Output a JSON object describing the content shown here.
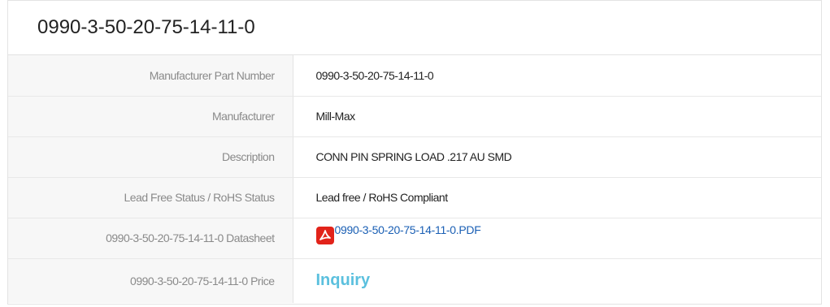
{
  "title": "0990-3-50-20-75-14-11-0",
  "rows": [
    {
      "label": "Manufacturer Part Number",
      "value": "0990-3-50-20-75-14-11-0"
    },
    {
      "label": "Manufacturer",
      "value": "Mill-Max"
    },
    {
      "label": "Description",
      "value": "CONN PIN SPRING LOAD .217 AU SMD"
    },
    {
      "label": "Lead Free Status / RoHS Status",
      "value": "Lead free / RoHS Compliant"
    },
    {
      "label": "0990-3-50-20-75-14-11-0 Datasheet",
      "value": "0990-3-50-20-75-14-11-0.PDF",
      "icon": "pdf-icon"
    },
    {
      "label": "0990-3-50-20-75-14-11-0 Price",
      "value": "Inquiry"
    }
  ],
  "colors": {
    "link": "#1a5fb4",
    "inquiry": "#5bc0de",
    "pdf_icon": "#e2231a",
    "label_bg": "#f7f7f7"
  }
}
